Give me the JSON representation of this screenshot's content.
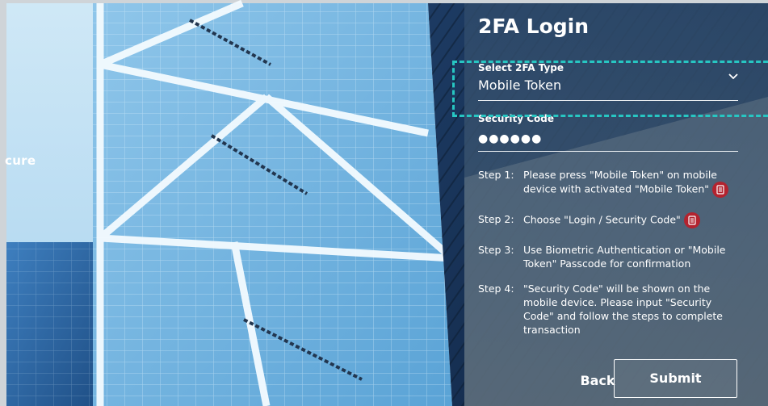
{
  "side_tag": "cure",
  "login": {
    "title": "2FA Login",
    "type_label": "Select 2FA Type",
    "type_value": "Mobile Token",
    "code_label": "Security Code",
    "code_value": "●●●●●●"
  },
  "steps": [
    {
      "label": "Step 1:",
      "text": "Please press \"Mobile Token\" on mobile device with activated \"Mobile Token\"",
      "icon": "mobile-token-icon"
    },
    {
      "label": "Step 2:",
      "text": "Choose \"Login / Security Code\"",
      "icon": "login-code-icon"
    },
    {
      "label": "Step 3:",
      "text": "Use Biometric Authentication or \"Mobile Token\" Passcode for confirmation"
    },
    {
      "label": "Step 4:",
      "text": "\"Security Code\" will be shown on the mobile device. Please input \"Security Code\" and follow the steps to complete transaction"
    }
  ],
  "buttons": {
    "back": "Back",
    "submit": "Submit"
  },
  "colors": {
    "accent_focus": "#27c6c2",
    "icon_red": "#b3232f",
    "panel_overlay": "#6f7d89"
  }
}
